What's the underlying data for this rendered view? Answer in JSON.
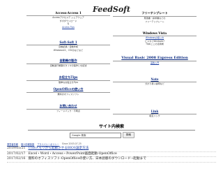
{
  "site_title": "FeedSoft",
  "left_column": [
    {
      "title": "Access-Access 1",
      "title_link": false,
      "lines": [
        {
          "text": "Accessアクセスデ シェアウェア",
          "link": false
        },
        {
          "text": "ダボダウンロード",
          "link": false
        },
        {
          "text": "&",
          "link": false
        },
        {
          "text": "Access Tips",
          "link": true
        }
      ]
    },
    {
      "title": "Soft-Soft 1",
      "title_link": true,
      "lines": [
        {
          "text": "自動記録 / 自動作成",
          "link": false
        },
        {
          "text": "Windows10、CSVのなどなど",
          "link": false
        }
      ]
    },
    {
      "title": "自動機の製作",
      "title_link": true,
      "lines": [
        {
          "text": "自動運行制御のタイマの製作とを記述",
          "link": false
        }
      ]
    },
    {
      "title": "お役立ちTips",
      "title_link": true,
      "lines": [
        {
          "text": "簡単なお役立ちTips",
          "link": false
        }
      ]
    },
    {
      "title": "OpenOfficeの使い方",
      "title_link": true,
      "lines": [
        {
          "text": "無料のオフィスソフト",
          "link": false
        }
      ]
    },
    {
      "title": "お問い合わせ",
      "title_link": true,
      "lines": [
        {
          "text": "フィードバック・不明点",
          "link": false
        }
      ]
    }
  ],
  "right_column": [
    {
      "title": "フリーテンプレート",
      "title_link": false,
      "large": false,
      "lines": [
        {
          "text": "見積書・請求書などの",
          "link": false
        },
        {
          "text": "フリーテンプレート",
          "link": false
        }
      ]
    },
    {
      "title": "Windows Vista",
      "title_link": false,
      "large": false,
      "lines": [
        {
          "text": "Windowsの使い方",
          "link": true
        },
        {
          "text": "ビスタとWindows7",
          "link": false
        },
        {
          "text": "Tips/ここの活用術",
          "link": false
        }
      ]
    },
    {
      "title": "Visual Basic 2008 Express Edition",
      "title_link": true,
      "large": true,
      "lines": [
        {
          "text": "実践入門",
          "link": true
        }
      ]
    },
    {
      "title": "Note",
      "title_link": true,
      "large": false,
      "lines": [
        {
          "text": "分かり易い説明など",
          "link": false
        }
      ]
    },
    {
      "title": "Link",
      "title_link": true,
      "large": false,
      "lines": [
        {
          "text": "相互リンク",
          "link": false
        }
      ]
    }
  ],
  "search": {
    "title": "サイト内検索",
    "placeholder": "Google 検索",
    "button_label": "検索"
  },
  "footer": {
    "items": [
      {
        "text": "運営者情報",
        "link": true
      },
      {
        "text": "個人情報保護",
        "link": true
      },
      {
        "text": "プライバシーポリシー",
        "link": true
      },
      {
        "text": "Since 2003.07.25",
        "link": false
      }
    ]
  },
  "news": [
    {
      "date": "2019/05/21",
      "text": "USBメモリから起動させるBIOS設定方法",
      "link": true
    },
    {
      "date": "2017/02/17",
      "text": "Excel・Word・Access・PowerPoint画面起動-OpenOffice",
      "link": false
    },
    {
      "date": "2017/02/16",
      "text": "無料のオフィスソフト-OpenOfficeの使い方、日本語版のダウンロード→起動まで",
      "link": false
    }
  ]
}
